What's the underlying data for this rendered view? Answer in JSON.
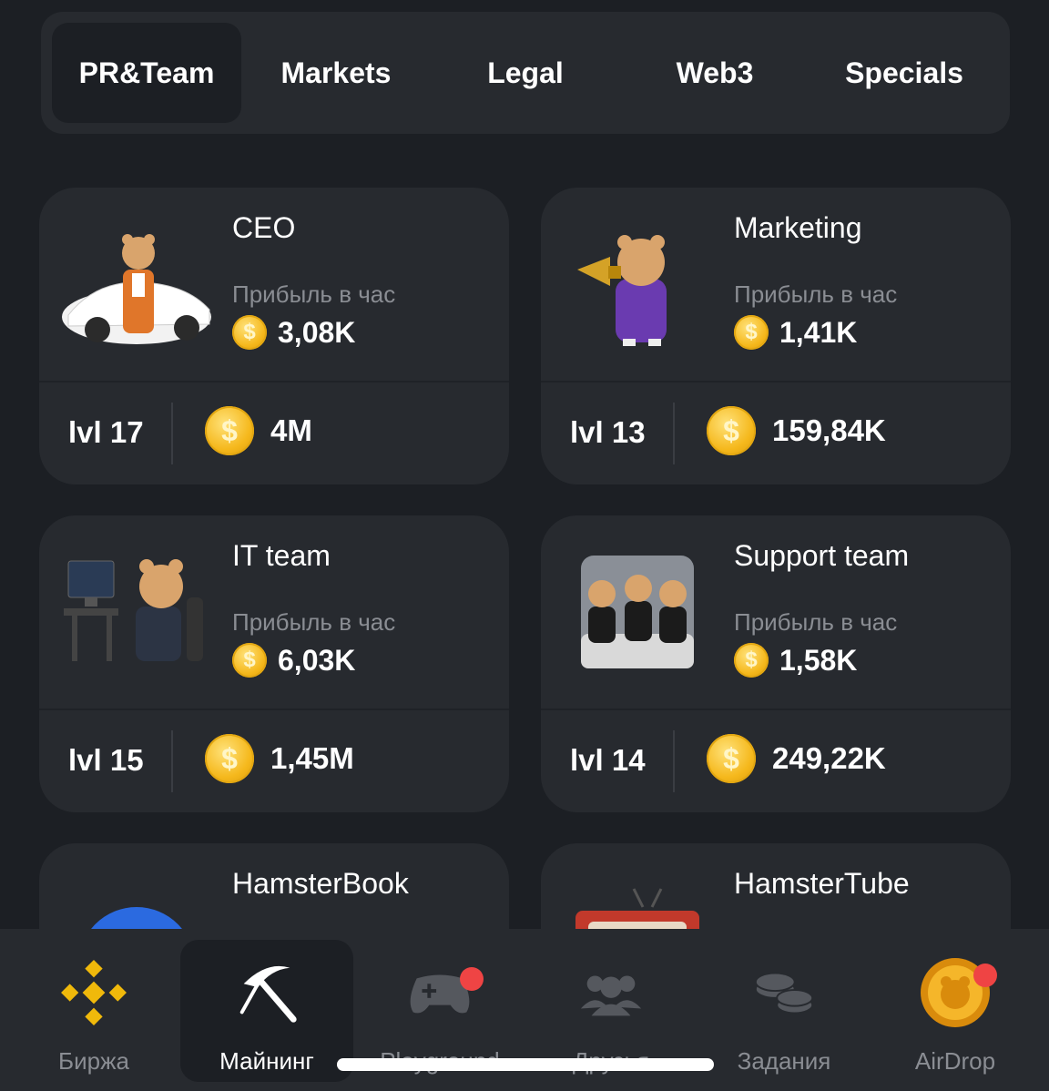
{
  "tabs": [
    "PR&Team",
    "Markets",
    "Legal",
    "Web3",
    "Specials"
  ],
  "active_tab": "PR&Team",
  "profit_label": "Прибыль в час",
  "coin_symbol": "$",
  "cards": [
    {
      "title": "CEO",
      "profit": "3,08K",
      "level": "lvl 17",
      "cost": "4M",
      "image": "hamster-ceo-car"
    },
    {
      "title": "Marketing",
      "profit": "1,41K",
      "level": "lvl 13",
      "cost": "159,84K",
      "image": "hamster-megaphone"
    },
    {
      "title": "IT team",
      "profit": "6,03K",
      "level": "lvl 15",
      "cost": "1,45M",
      "image": "hamster-computer"
    },
    {
      "title": "Support team",
      "profit": "1,58K",
      "level": "lvl 14",
      "cost": "249,22K",
      "image": "hamsters-support"
    },
    {
      "title": "HamsterBook",
      "image": "hamsterbook-logo"
    },
    {
      "title": "HamsterTube",
      "image": "hamster-tv"
    }
  ],
  "nav": [
    {
      "label": "Биржа",
      "icon": "binance-icon",
      "active": false,
      "badge": false
    },
    {
      "label": "Майнинг",
      "icon": "pickaxe-icon",
      "active": true,
      "badge": false
    },
    {
      "label": "Playground",
      "icon": "gamepad-icon",
      "active": false,
      "badge": true
    },
    {
      "label": "Друзья",
      "icon": "friends-icon",
      "active": false,
      "badge": false
    },
    {
      "label": "Задания",
      "icon": "coins-icon",
      "active": false,
      "badge": false
    },
    {
      "label": "AirDrop",
      "icon": "hamster-coin-icon",
      "active": false,
      "badge": true
    }
  ],
  "colors": {
    "background": "#1c1f24",
    "card": "#272a2f",
    "coin": "#f5b81c",
    "badge": "#ef4444",
    "muted": "#8a8d93"
  }
}
